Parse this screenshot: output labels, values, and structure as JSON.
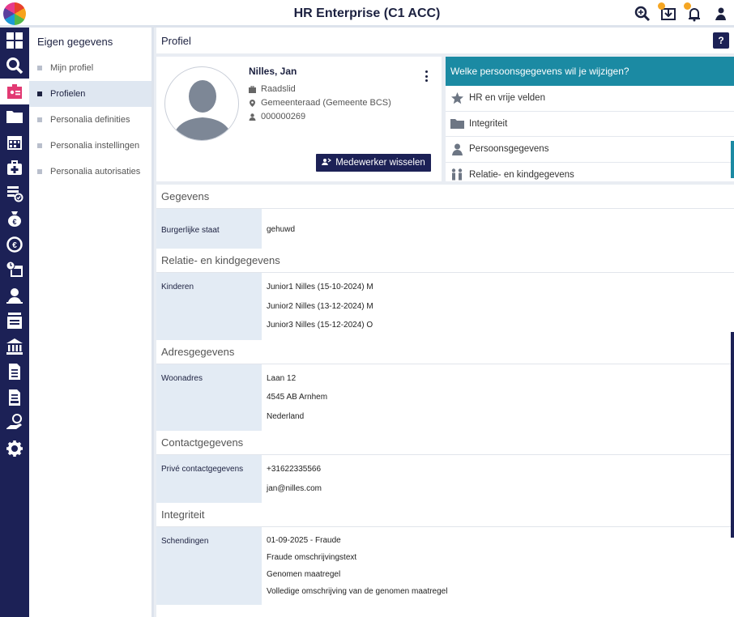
{
  "app": {
    "title": "HR Enterprise (C1 ACC)"
  },
  "topbar_icons": [
    "search-zoom-icon",
    "inbox-icon",
    "bell-icon",
    "user-icon"
  ],
  "rail_icons": [
    "grid-icon",
    "search-icon",
    "id-badge-icon",
    "folder-icon",
    "calendar-icon",
    "medical-kit-icon",
    "checklist-icon",
    "money-bag-icon",
    "euro-cycle-icon",
    "clock-calendar-icon",
    "user-presenter-icon",
    "contact-list-icon",
    "bank-icon",
    "document-icon",
    "document-list-icon",
    "hand-euro-icon",
    "gear-icon"
  ],
  "subnav": {
    "title": "Eigen gegevens",
    "items": [
      {
        "label": "Mijn profiel"
      },
      {
        "label": "Profielen"
      },
      {
        "label": "Personalia definities"
      },
      {
        "label": "Personalia instellingen"
      },
      {
        "label": "Personalia autorisaties"
      }
    ]
  },
  "main": {
    "title": "Profiel",
    "help": "?"
  },
  "profile": {
    "name": "Nilles, Jan",
    "role": "Raadslid",
    "department": "Gemeenteraad (Gemeente BCS)",
    "employee_number": "000000269",
    "switch_button": "Medewerker wisselen"
  },
  "change": {
    "heading": "Welke persoonsgegevens wil je wijzigen?",
    "items": [
      {
        "label": "HR en vrije velden",
        "icon": "star-icon"
      },
      {
        "label": "Integriteit",
        "icon": "folder-icon"
      },
      {
        "label": "Persoonsgegevens",
        "icon": "person-icon"
      },
      {
        "label": "Relatie- en kindgegevens",
        "icon": "family-icon"
      }
    ]
  },
  "details": {
    "gegevens": {
      "heading": "Gegevens",
      "burgerlijke_staat_label": "Burgerlijke staat",
      "burgerlijke_staat": "gehuwd"
    },
    "relatie": {
      "heading": "Relatie- en kindgegevens",
      "label": "Kinderen",
      "values": [
        "Junior1 Nilles (15-10-2024) M",
        "Junior2 Nilles (13-12-2024) M",
        "Junior3 Nilles (15-12-2024) O"
      ]
    },
    "adres": {
      "heading": "Adresgegevens",
      "label": "Woonadres",
      "values": [
        "Laan 12",
        "4545 AB Arnhem",
        "Nederland"
      ]
    },
    "contact": {
      "heading": "Contactgegevens",
      "label": "Privé contactgegevens",
      "values": [
        "+31622335566",
        "jan@nilles.com"
      ]
    },
    "integriteit": {
      "heading": "Integriteit",
      "label": "Schendingen",
      "values": [
        "01-09-2025 - Fraude",
        "Fraude omschrijvingstext",
        "Genomen maatregel",
        "Volledige omschrijving van de genomen maatregel"
      ]
    }
  },
  "colors": {
    "navy": "#1c2156",
    "teal": "#1b8aa3",
    "label_bg": "#e3ebf4"
  }
}
